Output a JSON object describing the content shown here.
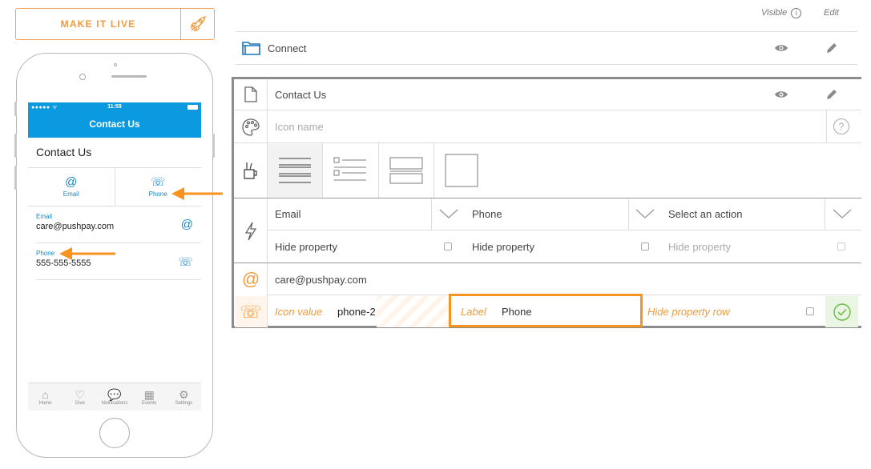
{
  "make_live": {
    "label": "MAKE IT LIVE",
    "icon": "rocket-icon"
  },
  "phone": {
    "status": {
      "signal": "●●●●● ᯤ",
      "time": "11:59"
    },
    "nav_title": "Contact Us",
    "heading": "Contact Us",
    "tabs": [
      {
        "icon": "@",
        "label": "Email"
      },
      {
        "icon": "☏",
        "label": "Phone"
      }
    ],
    "rows": [
      {
        "label": "Email",
        "value": "care@pushpay.com",
        "icon": "@"
      },
      {
        "label": "Phone",
        "value": "555-555-5555",
        "icon": "☏"
      }
    ],
    "tabbar": [
      {
        "icon": "⌂",
        "label": "Home"
      },
      {
        "icon": "♡",
        "label": "Give"
      },
      {
        "icon": "💬",
        "label": "Notifications"
      },
      {
        "icon": "▦",
        "label": "Events"
      },
      {
        "icon": "⚙",
        "label": "Settings"
      }
    ]
  },
  "panel": {
    "visible_header": "Visible",
    "edit_header": "Edit",
    "connect_label": "Connect",
    "contact_label": "Contact Us",
    "icon_name_placeholder": "Icon name",
    "property_selects": [
      "Email",
      "Phone",
      "Select an action"
    ],
    "hide_labels": [
      "Hide property",
      "Hide property",
      "Hide property"
    ],
    "email_value": "care@pushpay.com",
    "edit_row": {
      "icon_value_label": "Icon value",
      "icon_value": "phone-2",
      "label_label": "Label",
      "label_value": "Phone",
      "hide_row_label": "Hide property row"
    }
  },
  "colors": {
    "accent": "#f39a3c",
    "brand_blue": "#0b9ae0",
    "link_blue": "#1686c8",
    "connect_blue": "#1a73b8",
    "success": "#6cbf4a"
  }
}
